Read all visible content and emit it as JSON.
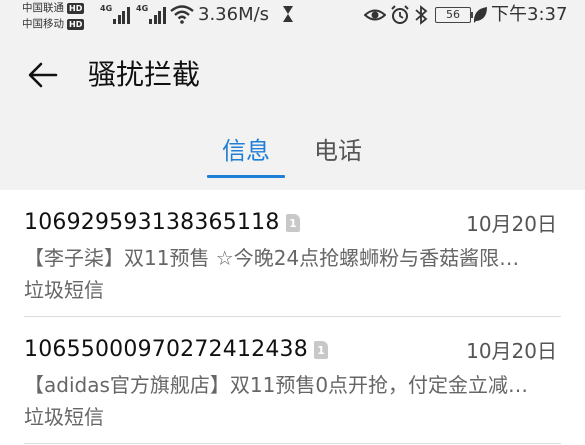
{
  "status_bar": {
    "carrier_1": "中国联通",
    "carrier_2": "中国移动",
    "hd_badge": "HD",
    "network_type": "4G",
    "speed": "3.36M/s",
    "battery_level": "56",
    "time": "下午3:37"
  },
  "header": {
    "title": "骚扰拦截",
    "tabs": [
      {
        "label": "信息",
        "active": true
      },
      {
        "label": "电话",
        "active": false
      }
    ]
  },
  "messages": [
    {
      "sender": "106929593138365118",
      "sim": "1",
      "date": "10月20日",
      "preview": "【李子柒】双11预售 ☆今晚24点抢螺蛳粉与香菇酱限…",
      "tag": "垃圾短信"
    },
    {
      "sender": "10655000970272412438",
      "sim": "1",
      "date": "10月20日",
      "preview": "【adidas官方旗舰店】双11预售0点开抢，付定金立减…",
      "tag": "垃圾短信"
    }
  ],
  "colors": {
    "accent": "#1f7fd6",
    "header_bg": "#f2f2f2",
    "secondary_text": "#666666"
  }
}
